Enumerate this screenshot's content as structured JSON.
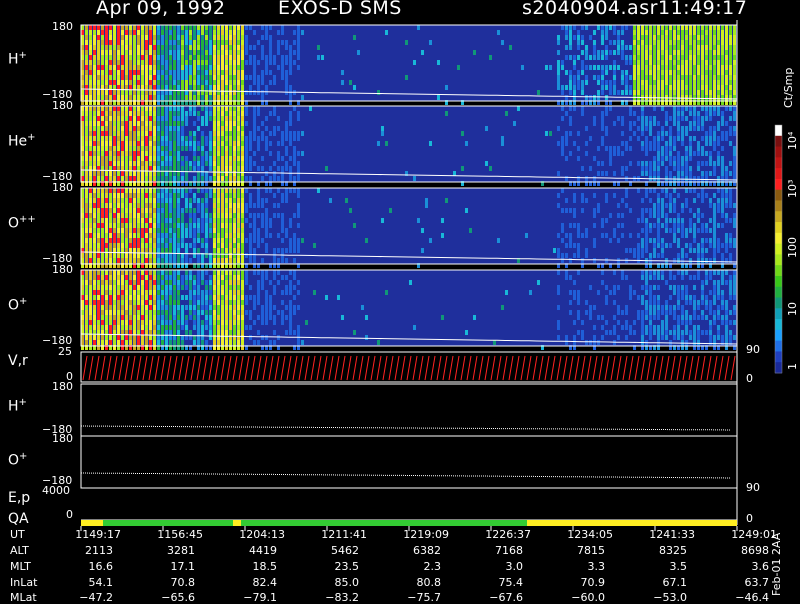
{
  "header": {
    "date": "Apr 09, 1992",
    "instrument": "EXOS-D SMS",
    "file": "s2040904.asr",
    "time": "11:49:17"
  },
  "colors": {
    "spectrogram_background": "#1f2f9c",
    "footprint_green": "#33cc33",
    "footprint_yellow": "#ffee22",
    "trace": "#ffffff",
    "velocity_bars": "#ff2222"
  },
  "panels": [
    {
      "label": "H",
      "sup": "+",
      "tick_top": "180",
      "tick_bottom": "−180"
    },
    {
      "label": "He",
      "sup": "+",
      "tick_top": "180",
      "tick_bottom": "−180"
    },
    {
      "label": "O",
      "sup": "++",
      "tick_top": "180",
      "tick_bottom": "−180"
    },
    {
      "label": "O",
      "sup": "+",
      "tick_top": "180",
      "tick_bottom": "−180"
    }
  ],
  "velocity_panel": {
    "label": "V,r",
    "tick_top": "25",
    "tick_bottom": "0",
    "right_top": "90",
    "right_bottom": "0"
  },
  "line_panels": [
    {
      "label": "H",
      "sup": "+",
      "tick_top": "180",
      "tick_bottom": "−180"
    },
    {
      "label": "O",
      "sup": "+",
      "tick_top": "180",
      "tick_bottom": "−180"
    }
  ],
  "ep_panel": {
    "label": "E,p",
    "tick": "4000",
    "right_top": "90"
  },
  "qa_panel": {
    "label": "QA",
    "tick": "0",
    "right": "0"
  },
  "colorbar": {
    "title": "Ct/Smp",
    "labels": [
      "10⁴",
      "10³",
      "100",
      "10",
      "1"
    ],
    "colors": [
      "#ffffff",
      "#7a1010",
      "#a01010",
      "#c01414",
      "#e01818",
      "#ff2020",
      "#8a5a10",
      "#a8801a",
      "#c6a820",
      "#e0d020",
      "#f4ee30",
      "#d0f020",
      "#a8e81c",
      "#70d818",
      "#38c818",
      "#20b040",
      "#109878",
      "#10a0b8",
      "#18b8d8",
      "#1aa0ff",
      "#2070e8",
      "#2040c0",
      "#1a2a9a"
    ]
  },
  "chart_data": {
    "type": "heatmap",
    "title": "Apr 09, 1992   EXOS-D SMS   s2040904.asr  11:49:17",
    "panels": [
      "H+",
      "He+",
      "O++",
      "O+"
    ],
    "ylim": [
      -180,
      180
    ],
    "colorbar_label": "Ct/Smp",
    "colorbar_ticks": [
      "1",
      "10",
      "100",
      "10^3",
      "10^4"
    ],
    "x_axis_times": [
      "1149:17",
      "1156:45",
      "1204:13",
      "1211:41",
      "1219:09",
      "1226:37",
      "1234:05",
      "1241:33",
      "1249:01"
    ]
  },
  "footer": {
    "rows": [
      {
        "label": "UT",
        "values": [
          "1149:17",
          "1156:45",
          "1204:13",
          "1211:41",
          "1219:09",
          "1226:37",
          "1234:05",
          "1241:33",
          "1249:01"
        ]
      },
      {
        "label": "ALT",
        "values": [
          "2113",
          "3281",
          "4419",
          "5462",
          "6382",
          "7168",
          "7815",
          "8325",
          "8698"
        ]
      },
      {
        "label": "MLT",
        "values": [
          "16.6",
          "17.1",
          "18.5",
          "23.5",
          "2.3",
          "3.0",
          "3.3",
          "3.5",
          "3.6"
        ]
      },
      {
        "label": "InLat",
        "values": [
          "54.1",
          "70.8",
          "82.4",
          "85.0",
          "80.8",
          "75.4",
          "70.9",
          "67.1",
          "63.7"
        ]
      },
      {
        "label": "MLat",
        "values": [
          "−47.2",
          "−65.6",
          "−79.1",
          "−83.2",
          "−75.7",
          "−67.6",
          "−60.0",
          "−53.0",
          "−46.4"
        ]
      }
    ],
    "version": "Feb-01 2AA"
  }
}
